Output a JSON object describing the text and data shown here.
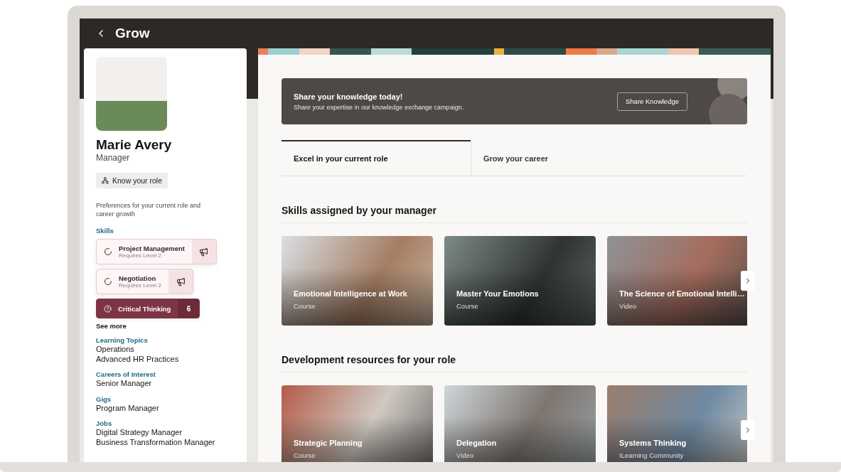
{
  "app": {
    "title": "Grow"
  },
  "profile": {
    "name": "Marie Avery",
    "role": "Manager",
    "role_button": "Know your role",
    "preferences_text": "Preferences for your current role and career growth",
    "skills_label": "Skills",
    "skills": [
      {
        "kind": "pending",
        "name": "Project Management",
        "note": "Requires Level 2"
      },
      {
        "kind": "pending",
        "name": "Negotiation",
        "note": "Requires Level 2"
      },
      {
        "kind": "count",
        "name": "Critical Thinking",
        "count": "6"
      }
    ],
    "see_more": "See more",
    "sections": [
      {
        "label": "Learning Topics",
        "items": [
          "Operations",
          "Advanced HR Practices"
        ]
      },
      {
        "label": "Careers of Interest",
        "items": [
          "Senior Manager"
        ]
      },
      {
        "label": "Gigs",
        "items": [
          "Program Manager"
        ]
      },
      {
        "label": "Jobs",
        "items": [
          "Digital Strategy Manager",
          "Business Transformation Manager"
        ]
      }
    ]
  },
  "banner": {
    "title": "Share your knowledge today!",
    "text": "Share your expertise in our knowledge exchange campaign.",
    "button": "Share Knowledge"
  },
  "tabs": [
    {
      "label": "Excel in your current role",
      "selected": true
    },
    {
      "label": "Grow your career",
      "selected": false
    }
  ],
  "carousels": [
    {
      "heading": "Skills assigned by your manager",
      "cards": [
        {
          "title": "Emotional Intelligence at Work",
          "type": "Course"
        },
        {
          "title": "Master Your Emotions",
          "type": "Course"
        },
        {
          "title": "The Science of Emotional Intelli…",
          "type": "Video"
        }
      ]
    },
    {
      "heading": "Development resources for your role",
      "cards": [
        {
          "title": "Strategic Planning",
          "type": "Course"
        },
        {
          "title": "Delegation",
          "type": "Video"
        },
        {
          "title": "Systems Thinking",
          "type": "ILearning Community"
        }
      ]
    }
  ]
}
